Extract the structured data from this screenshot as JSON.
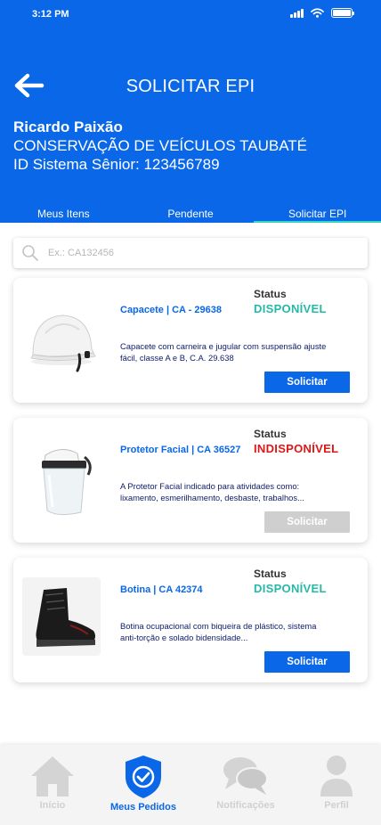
{
  "status_bar": {
    "time": "3:12 PM"
  },
  "header": {
    "title": "SOLICITAR EPI",
    "user_name": "Ricardo Paixão",
    "department": "CONSERVAÇÃO DE VEÍCULOS TAUBATÉ",
    "system_id": "ID Sistema Sênior: 123456789"
  },
  "tabs": [
    {
      "label": "Meus Itens"
    },
    {
      "label": "Pendente"
    },
    {
      "label": "Solicitar EPI",
      "active": true
    }
  ],
  "search": {
    "placeholder": "Ex.: CA132456",
    "value": ""
  },
  "colors": {
    "primary": "#0a67e8",
    "available": "#27b9a8",
    "unavailable": "#e01717",
    "disabled": "#cfcfcf"
  },
  "items": [
    {
      "name": "Capacete | CA - 29638",
      "status_label": "Status",
      "status": "DISPONÍVEL",
      "available": true,
      "description": "Capacete com carneira e jugular com  suspensão ajuste fácil, classe A e B, C.A. 29.638",
      "button": "Solicitar",
      "icon": "helmet-image"
    },
    {
      "name": "Protetor Facial | CA 36527",
      "status_label": "Status",
      "status": "INDISPONÍVEL",
      "available": false,
      "description": "A Protetor Facial indicado para atividades como: lixamento, esmerilhamento, desbaste, trabalhos...",
      "button": "Solicitar",
      "icon": "face-shield-image"
    },
    {
      "name": "Botina | CA 42374",
      "status_label": "Status",
      "status": "DISPONÍVEL",
      "available": true,
      "description": "Botina ocupacional com biqueira de plástico, sistema anti-torção e solado bidensidade...",
      "button": "Solicitar",
      "icon": "boot-image"
    }
  ],
  "bottom_nav": [
    {
      "label": "Início",
      "icon": "home-icon"
    },
    {
      "label": "Meus Pedidos",
      "icon": "shield-check-icon",
      "active": true
    },
    {
      "label": "Notificações",
      "icon": "chat-icon"
    },
    {
      "label": "Perfil",
      "icon": "user-icon"
    }
  ]
}
